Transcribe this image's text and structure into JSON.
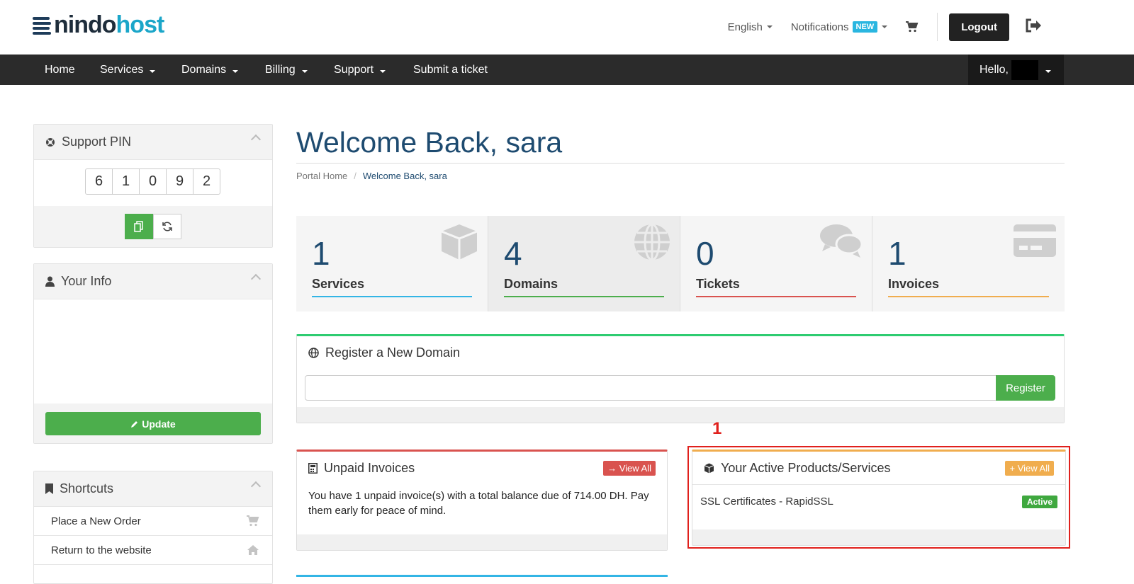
{
  "brand": {
    "part1": "nindo",
    "part2": "host"
  },
  "topnav": {
    "language": "English",
    "notifications": "Notifications",
    "notifications_badge": "NEW",
    "logout": "Logout"
  },
  "nav": {
    "items": [
      "Home",
      "Services",
      "Domains",
      "Billing",
      "Support",
      "Submit a ticket"
    ],
    "hello": "Hello,"
  },
  "sidebar": {
    "support_pin": {
      "title": "Support PIN",
      "digits": [
        "6",
        "1",
        "0",
        "9",
        "2"
      ]
    },
    "your_info": {
      "title": "Your Info",
      "update_label": "Update"
    },
    "shortcuts": {
      "title": "Shortcuts",
      "items": [
        {
          "label": "Place a New Order",
          "icon": "cart-icon"
        },
        {
          "label": "Return to the website",
          "icon": "home-icon"
        }
      ]
    }
  },
  "main": {
    "title": "Welcome Back, sara",
    "breadcrumb": {
      "home": "Portal Home",
      "current": "Welcome Back, sara"
    },
    "tiles": [
      {
        "count": "1",
        "label": "Services",
        "color": "#33b5e5",
        "icon": "cube-icon"
      },
      {
        "count": "4",
        "label": "Domains",
        "color": "#4cae4c",
        "icon": "globe-icon"
      },
      {
        "count": "0",
        "label": "Tickets",
        "color": "#d9534f",
        "icon": "chat-icon"
      },
      {
        "count": "1",
        "label": "Invoices",
        "color": "#f0ad4e",
        "icon": "credit-card-icon"
      }
    ],
    "register_domain": {
      "title": "Register a New Domain",
      "button": "Register",
      "accent": "#2ecc71"
    },
    "unpaid_invoices": {
      "title": "Unpaid Invoices",
      "view_all": "View All",
      "accent": "#d9534f",
      "message": "You have 1 unpaid invoice(s) with a total balance due of 714.00 DH. Pay them early for peace of mind."
    },
    "active_products": {
      "title": "Your Active Products/Services",
      "view_all": "View All",
      "accent": "#f0ad4e",
      "items": [
        {
          "name": "SSL Certificates - RapidSSL",
          "status": "Active"
        }
      ]
    },
    "annotation_marker": "1"
  }
}
